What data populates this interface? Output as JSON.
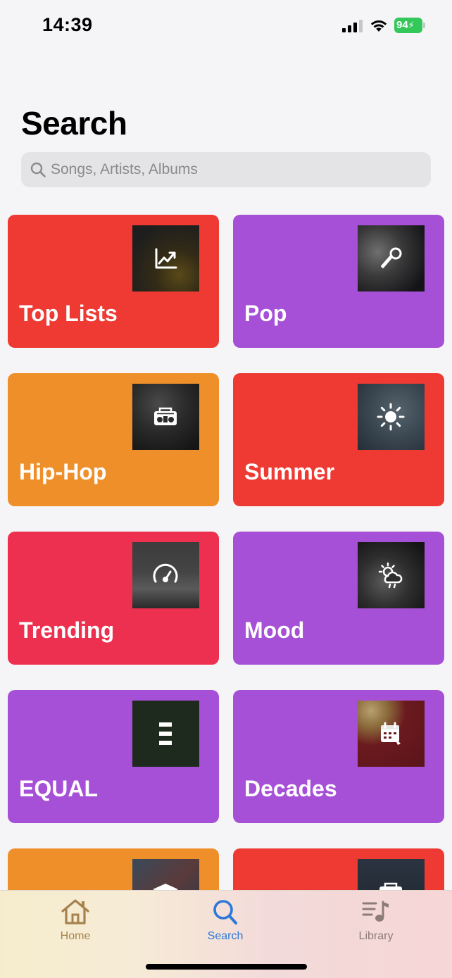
{
  "status_bar": {
    "time": "14:39",
    "battery": "94"
  },
  "page": {
    "title": "Search"
  },
  "search": {
    "placeholder": "Songs, Artists, Albums",
    "value": "",
    "icon": "magnifier-icon"
  },
  "categories": [
    {
      "label": "Top Lists",
      "color": "#ee3a33",
      "icon": "chart-trend-icon"
    },
    {
      "label": "Pop",
      "color": "#a64fd7",
      "icon": "microphone-icon"
    },
    {
      "label": "Hip-Hop",
      "color": "#ee8f2a",
      "icon": "boombox-icon"
    },
    {
      "label": "Summer",
      "color": "#ee3a33",
      "icon": "sun-icon"
    },
    {
      "label": "Trending",
      "color": "#ee3050",
      "icon": "speedometer-icon"
    },
    {
      "label": "Mood",
      "color": "#a64fd7",
      "icon": "sun-cloud-rain-icon"
    },
    {
      "label": "EQUAL",
      "color": "#a64fd7",
      "icon": "equal-bars-icon"
    },
    {
      "label": "Decades",
      "color": "#a64fd7",
      "icon": "calendar-icon"
    },
    {
      "label": "",
      "color": "#ee8f2a",
      "icon": "graduation-cap-icon"
    },
    {
      "label": "",
      "color": "#ee3a33",
      "icon": "boombox-icon"
    }
  ],
  "tab_bar": {
    "tabs": [
      {
        "label": "Home",
        "icon": "house-icon",
        "selected": false
      },
      {
        "label": "Search",
        "icon": "magnifier-icon",
        "selected": true
      },
      {
        "label": "Library",
        "icon": "music-library-icon",
        "selected": false
      }
    ]
  }
}
